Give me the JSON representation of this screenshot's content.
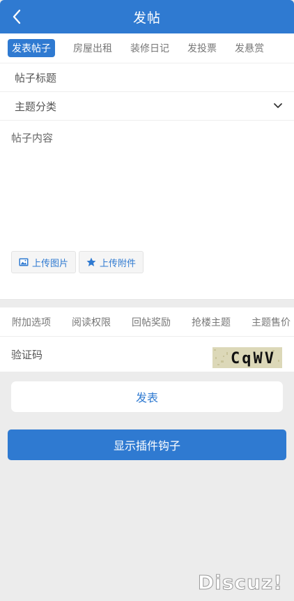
{
  "header": {
    "title": "发帖",
    "back_icon": "back-arrow-icon"
  },
  "post_tabs": [
    {
      "label": "发表帖子",
      "active": true
    },
    {
      "label": "房屋出租",
      "active": false
    },
    {
      "label": "装修日记",
      "active": false
    },
    {
      "label": "发投票",
      "active": false
    },
    {
      "label": "发悬赏",
      "active": false
    }
  ],
  "form": {
    "title_placeholder": "帖子标题",
    "category_label": "主题分类",
    "content_placeholder": "帖子内容",
    "upload_image_label": "上传图片",
    "upload_attachment_label": "上传附件"
  },
  "option_tabs": [
    "附加选项",
    "阅读权限",
    "回帖奖励",
    "抢楼主题",
    "主题售价"
  ],
  "captcha": {
    "label": "验证码",
    "code": "CqWV"
  },
  "buttons": {
    "submit": "发表",
    "show_hooks": "显示插件钩子"
  },
  "brand": {
    "logo": "Discuz!"
  },
  "colors": {
    "accent": "#2f7ad1",
    "background": "#ececec"
  }
}
